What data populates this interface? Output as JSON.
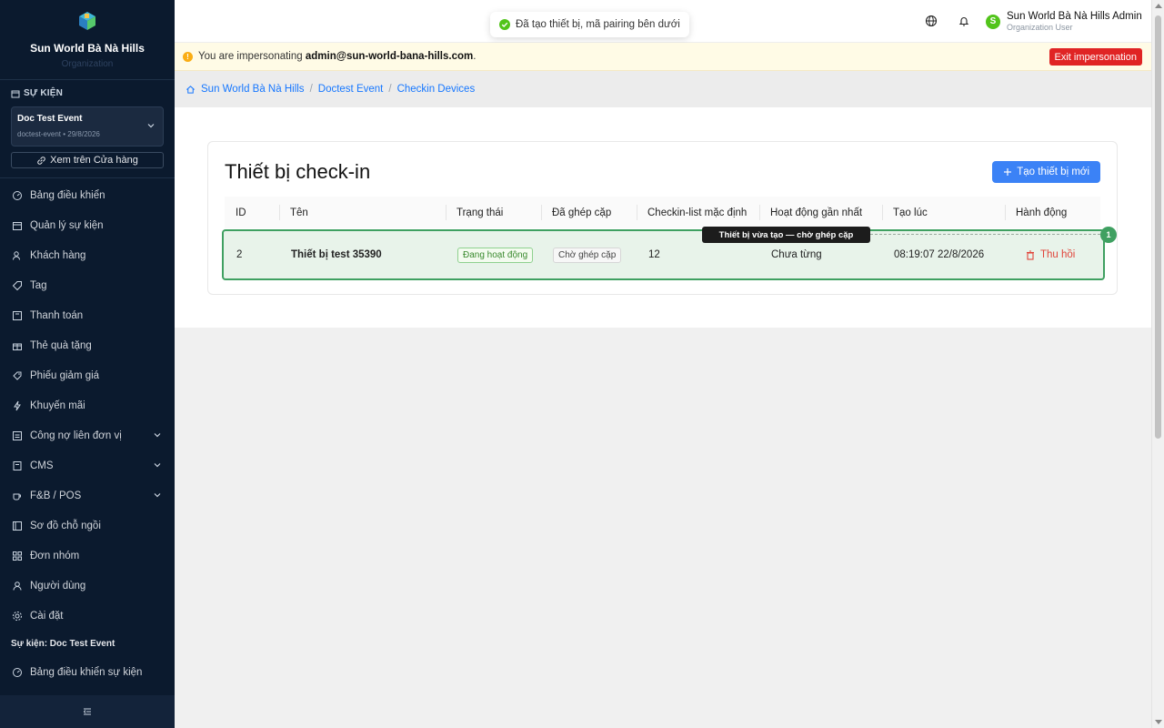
{
  "brand": {
    "name": "Sun World Bà Nà Hills",
    "subtitle": "Organization"
  },
  "sidebar": {
    "event_section": "SỰ KIỆN",
    "event_select": {
      "title": "Doc Test Event",
      "meta": "doctest-event • 29/8/2026"
    },
    "store_link": "Xem trên Cửa hàng",
    "items": [
      {
        "label": "Bảng điều khiển",
        "icon": "dashboard-icon"
      },
      {
        "label": "Quản lý sự kiện",
        "icon": "calendar-icon"
      },
      {
        "label": "Khách hàng",
        "icon": "users-icon"
      },
      {
        "label": "Tag",
        "icon": "tag-icon"
      },
      {
        "label": "Thanh toán",
        "icon": "payment-icon"
      },
      {
        "label": "Thẻ quà tặng",
        "icon": "gift-icon"
      },
      {
        "label": "Phiếu giảm giá",
        "icon": "coupon-icon"
      },
      {
        "label": "Khuyến mãi",
        "icon": "lightning-icon"
      },
      {
        "label": "Công nợ liên đơn vị",
        "icon": "ledger-icon"
      },
      {
        "label": "CMS",
        "icon": "document-icon"
      },
      {
        "label": "F&B / POS",
        "icon": "coffee-icon"
      },
      {
        "label": "Sơ đồ chỗ ngồi",
        "icon": "seat-map-icon"
      },
      {
        "label": "Đơn nhóm",
        "icon": "grid-icon"
      },
      {
        "label": "Người dùng",
        "icon": "user-icon"
      },
      {
        "label": "Cài đặt",
        "icon": "gear-icon"
      }
    ],
    "event_subsection": "Sự kiện: Doc Test Event",
    "event_items": [
      {
        "label": "Bảng điều khiển sự kiện",
        "icon": "dashboard-icon"
      }
    ]
  },
  "header": {
    "toast": "Đã tạo thiết bị, mã pairing bên dưới",
    "user": {
      "initial": "S",
      "name": "Sun World Bà Nà Hills Admin",
      "role": "Organization User"
    }
  },
  "impersonation": {
    "prefix": "You are impersonating",
    "email": "admin@sun-world-bana-hills.com",
    "suffix": ".",
    "exit_label": "Exit impersonation"
  },
  "breadcrumb": [
    "Sun World Bà Nà Hills",
    "Doctest Event",
    "Checkin Devices"
  ],
  "main": {
    "title": "Thiết bị check-in",
    "new_button": "Tạo thiết bị mới",
    "columns": [
      "ID",
      "Tên",
      "Trạng thái",
      "Đã ghép cặp",
      "Checkin-list mặc định",
      "Hoạt động gần nhất",
      "Tạo lúc",
      "Hành động"
    ],
    "rows": [
      {
        "id": "2",
        "name": "Thiết bị test 35390",
        "status": "Đang hoạt động",
        "paired": "Chờ ghép cặp",
        "checkin_list": "12",
        "last_activity": "Chưa từng",
        "created_at": "08:19:07 22/8/2026",
        "action": "Thu hồi"
      }
    ],
    "annotation": {
      "tooltip": "Thiết bị vừa tạo — chờ ghép cặp",
      "badge": "1"
    }
  },
  "colors": {
    "sidebar_bg": "#0b1a2e",
    "primary": "#3b82f6",
    "danger": "#e02424",
    "success": "#3fa061"
  }
}
